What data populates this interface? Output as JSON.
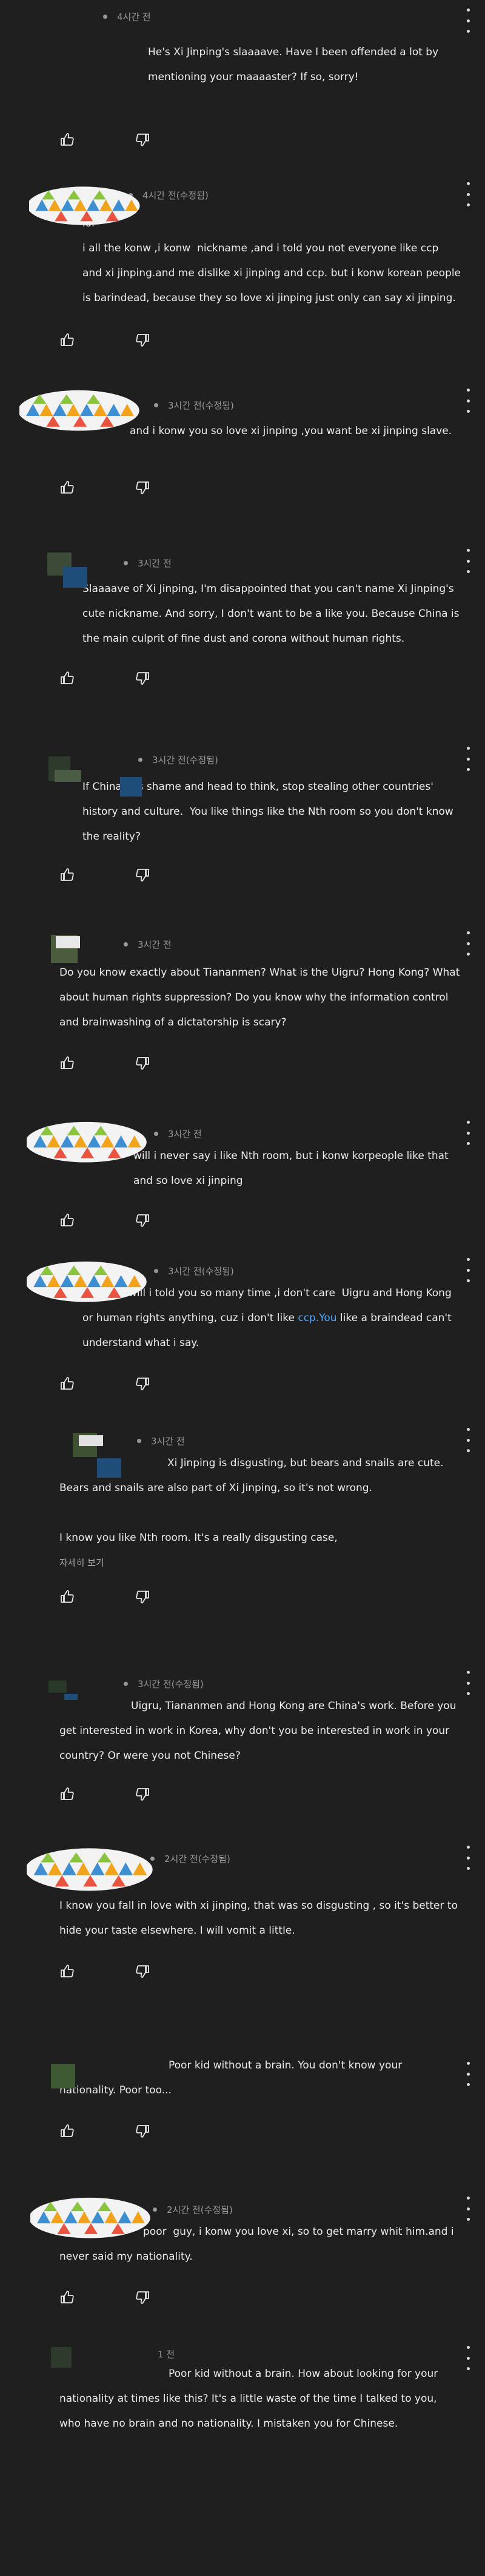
{
  "icons": {
    "like": "thumbs-up-icon",
    "dislike": "thumbs-down-icon",
    "menu": "more-vert-icon"
  },
  "colors": {
    "background": "#1f1f1f",
    "text": "#ededed",
    "muted": "#9a9a9a",
    "link": "#4ea8ff"
  },
  "comments": [
    {
      "time": "4시간 전",
      "text": "He's Xi Jinping's slaaaave. Have I been offended a lot by mentioning your maaaaster? If so, sorry!"
    },
    {
      "time": "4시간 전(수정됨)",
      "text": "lol\ni all the konw ,i konw  nickname ,and i told you not everyone like ccp and xi jinping.and me dislike xi jinping and ccp. but i konw korean people is barindead, because they so love xi jinping just only can say xi jinping."
    },
    {
      "time": "3시간 전(수정됨)",
      "text": "and i konw you so love xi jinping ,you want be xi jinping slave."
    },
    {
      "time": "3시간 전",
      "text": "Slaaaave of Xi Jinping, I'm disappointed that you can't name Xi Jinping's cute nickname. And sorry, I don't want to be a like you. Because China is the main culprit of fine dust and corona without human rights."
    },
    {
      "time": "3시간 전(수정됨)",
      "text": "If China has shame and head to think, stop stealing other countries' history and culture.  You like things like the Nth room so you don't know the reality?"
    },
    {
      "time": "3시간 전",
      "text": "Do you know exactly about Tiananmen? What is the Uigru? Hong Kong? What about human rights suppression? Do you know why the information control and brainwashing of a dictatorship is scary?"
    },
    {
      "time": "3시간 전",
      "text": "will i never say i like Nth room, but i konw korpeople like that and so love xi jinping"
    },
    {
      "time": "3시간 전(수정됨)",
      "text_before": "will i told you so many time ,i don't care  Uigru and Hong Kong  or human rights anything, cuz i don't like ",
      "link": "ccp.You",
      "text_after": " like a braindead can't understand what i say."
    },
    {
      "time": "3시간 전",
      "text": "Xi Jinping is disgusting, but bears and snails are cute. Bears and snails are also part of Xi Jinping, so it's not wrong.\n\nI know you like Nth room. It's a really disgusting case,",
      "more": "자세히 보기"
    },
    {
      "time": "3시간 전(수정됨)",
      "text": "Uigru, Tiananmen and Hong Kong are China's work. Before you get interested in work in Korea, why don't you be interested in work in your country? Or were you not Chinese?"
    },
    {
      "time": "2시간 전(수정됨)",
      "text": "lmfao\nI know you fall in love with xi jinping, that was so disgusting , so it's better to hide your taste elsewhere. I will vomit a little."
    },
    {
      "time": "",
      "text": "Poor kid without a brain. You don't know your nationality. Poor too..."
    },
    {
      "time": "2시간 전(수정됨)",
      "text": "poor  guy, i konw you love xi, so to get marry whit him.and i never said my nationality."
    },
    {
      "time": "1 전",
      "text": "Poor kid without a brain. How about looking for your nationality at times like this? It's a little waste of the time I talked to you, who have no brain and no nationality. I mistaken you for Chinese."
    }
  ]
}
